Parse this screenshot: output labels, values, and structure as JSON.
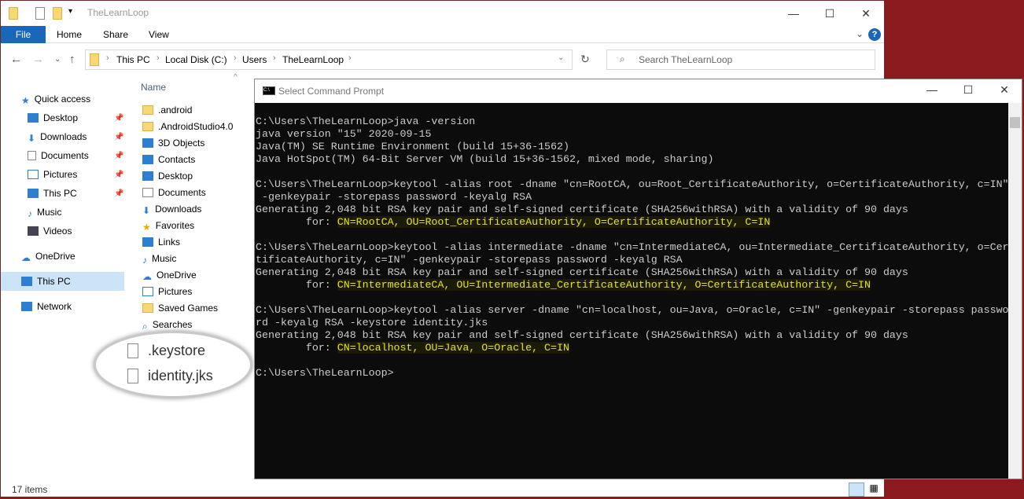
{
  "explorer": {
    "title": "TheLearnLoop",
    "ribbon_tabs": [
      "File",
      "Home",
      "Share",
      "View"
    ],
    "help": "?",
    "breadcrumb": [
      "This PC",
      "Local Disk (C:)",
      "Users",
      "TheLearnLoop"
    ],
    "search_placeholder": "Search TheLearnLoop",
    "sidebar": [
      "Quick access",
      "Desktop",
      "Downloads",
      "Documents",
      "Pictures",
      "This PC",
      "Music",
      "Videos",
      "OneDrive",
      "This PC",
      "Network"
    ],
    "column_name": "Name",
    "files": [
      ".android",
      ".AndroidStudio4.0",
      "3D Objects",
      "Contacts",
      "Desktop",
      "Documents",
      "Downloads",
      "Favorites",
      "Links",
      "Music",
      "OneDrive",
      "Pictures",
      "Saved Games",
      "Searches"
    ],
    "callout_files": [
      ".keystore",
      "identity.jks"
    ],
    "status": "17 items"
  },
  "cmd": {
    "title": "Select Command Prompt",
    "lines": [
      "C:\\Users\\TheLearnLoop>java -version",
      "java version \"15\" 2020-09-15",
      "Java(TM) SE Runtime Environment (build 15+36-1562)",
      "Java HotSpot(TM) 64-Bit Server VM (build 15+36-1562, mixed mode, sharing)",
      "",
      "C:\\Users\\TheLearnLoop>keytool -alias root -dname \"cn=RootCA, ou=Root_CertificateAuthority, o=CertificateAuthority, c=IN\"",
      " -genkeypair -storepass password -keyalg RSA",
      "Generating 2,048 bit RSA key pair and self-signed certificate (SHA256withRSA) with a validity of 90 days"
    ],
    "for1": "CN=RootCA, OU=Root_CertificateAuthority, O=CertificateAuthority, C=IN",
    "lines2": [
      "",
      "C:\\Users\\TheLearnLoop>keytool -alias intermediate -dname \"cn=IntermediateCA, ou=Intermediate_CertificateAuthority, o=Cer",
      "tificateAuthority, c=IN\" -genkeypair -storepass password -keyalg RSA",
      "Generating 2,048 bit RSA key pair and self-signed certificate (SHA256withRSA) with a validity of 90 days"
    ],
    "for2": "CN=IntermediateCA, OU=Intermediate_CertificateAuthority, O=CertificateAuthority, C=IN",
    "lines3": [
      "",
      "C:\\Users\\TheLearnLoop>keytool -alias server -dname \"cn=localhost, ou=Java, o=Oracle, c=IN\" -genkeypair -storepass passwo",
      "rd -keyalg RSA -keystore identity.jks",
      "Generating 2,048 bit RSA key pair and self-signed certificate (SHA256withRSA) with a validity of 90 days"
    ],
    "for3": "CN=localhost, OU=Java, O=Oracle, C=IN",
    "for_label": "        for: ",
    "prompt": "C:\\Users\\TheLearnLoop>"
  }
}
